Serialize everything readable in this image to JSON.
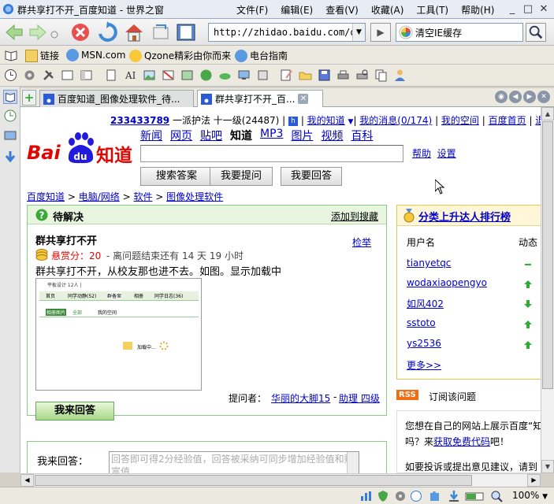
{
  "window": {
    "title": "群共享打不开_百度知道 - 世界之窗",
    "menus": [
      "文件(F)",
      "编辑(E)",
      "查看(V)",
      "收藏(A)",
      "工具(T)",
      "帮助(H)"
    ],
    "controls": [
      "_",
      "□",
      "✕"
    ]
  },
  "nav": {
    "url": "http://zhidao.baidu.com/que",
    "search_text": "清空IE缓存"
  },
  "links_bar": [
    "链接",
    "MSN.com",
    "Qzone精彩由你而来",
    "电台指南"
  ],
  "tabs": [
    {
      "label": "百度知道_图像处理软件_待..."
    },
    {
      "label": "群共享打不开_百..."
    }
  ],
  "page": {
    "user": {
      "id": "233433789",
      "rest1": " 一派护法  十一级(24487) | ",
      "my_know": "我的知道",
      "my_msg": "我的消息(0/174)",
      "my_space": "我的空间",
      "home": "百度首页",
      "logout": "退出"
    },
    "logo_text": "知道",
    "channels": [
      "新闻",
      "网页",
      "贴吧",
      "知道",
      "MP3",
      "图片",
      "视频",
      "百科"
    ],
    "help": "帮助",
    "settings": "设置",
    "buttons": [
      "搜索答案",
      "我要提问",
      "我要回答"
    ],
    "breadcrumb": [
      "百度知道",
      "电脑/网络",
      "软件",
      "图像处理软件"
    ],
    "pending": {
      "title": "待解决",
      "add_search": "添加到搜藏",
      "question_title": "群共享打不开",
      "report": "检举",
      "reward_label": "悬赏分：20",
      "time_left": " - 离问题结束还有  14 天  19 小时",
      "body": "群共享打不开，从校友那也进不去。如图。显示加载中",
      "asker_label": "提问者：",
      "asker": "华丽的大脚15",
      "asker_level": "助理  四级",
      "answer_button": "我来回答"
    },
    "screenshot": {
      "header": "平板设计 12人  |  ",
      "tabs": [
        "首页",
        "同学动静(52)",
        "群备案",
        "相册",
        "同学日志(36)"
      ],
      "sub": [
        "相册图片",
        "全部",
        "我的空间"
      ],
      "loading": "加载中..."
    },
    "answer": {
      "label": "我来回答：",
      "placeholder": "回答即可得2分经验值，回答被采纳可同步增加经验值和财富值"
    },
    "ranking": {
      "title": "分类上升达人排行榜",
      "col_user": "用户名",
      "col_trend": "动态",
      "users": [
        {
          "name": "tianyetqc",
          "trend": "same"
        },
        {
          "name": "wodaxiaopengyo",
          "trend": "up"
        },
        {
          "name": "如风402",
          "trend": "down"
        },
        {
          "name": "sstoto",
          "trend": "up"
        },
        {
          "name": "ys2536",
          "trend": "up"
        }
      ],
      "more": "更多>>"
    },
    "rss": {
      "badge": "RSS",
      "text": "订阅该问题"
    },
    "promo": {
      "line1": "您想在自己的网站上展示百度“知",
      "line2a": "吗？来",
      "line2b": "获取免费代码",
      "line2c": "吧！",
      "line3": "如要投诉或提出意见建议，请到"
    }
  },
  "status": {
    "zoom": "100%"
  }
}
